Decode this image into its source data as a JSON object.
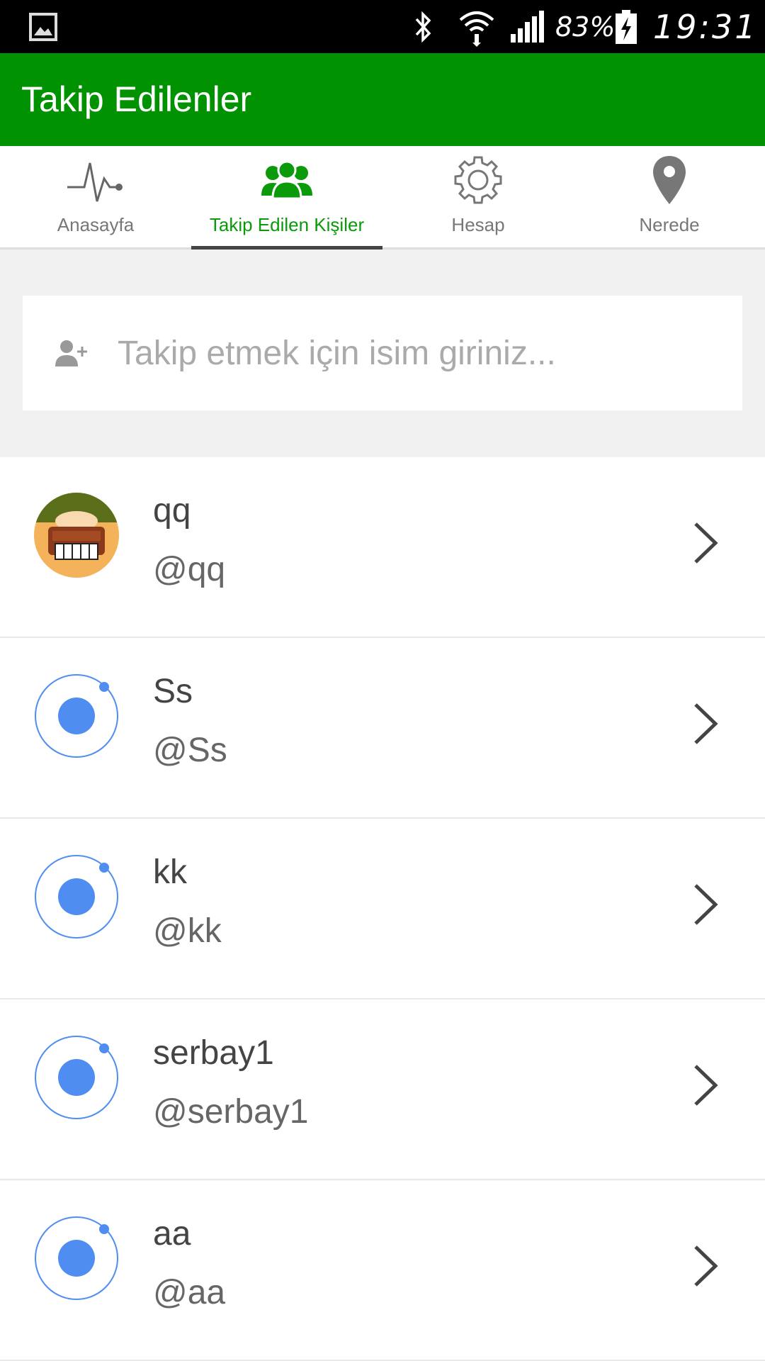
{
  "status_bar": {
    "battery": "83%",
    "time": "19:31",
    "icons": [
      "gallery-icon",
      "bluetooth-icon",
      "wifi-icon",
      "signal-icon",
      "battery-charging-icon"
    ]
  },
  "app_bar": {
    "title": "Takip Edilenler"
  },
  "tabs": [
    {
      "label": "Anasayfa",
      "icon": "pulse-icon"
    },
    {
      "label": "Takip Edilen Kişiler",
      "icon": "people-icon",
      "active": true
    },
    {
      "label": "Hesap",
      "icon": "gear-icon"
    },
    {
      "label": "Nerede",
      "icon": "location-pin-icon"
    }
  ],
  "search": {
    "placeholder": "Takip etmek için isim giriniz...",
    "value": "",
    "icon": "add-user-icon"
  },
  "users": [
    {
      "name": "qq",
      "handle": "@qq",
      "avatar": "photo"
    },
    {
      "name": "Ss",
      "handle": "@Ss",
      "avatar": "default"
    },
    {
      "name": "kk",
      "handle": "@kk",
      "avatar": "default"
    },
    {
      "name": "serbay1",
      "handle": "@serbay1",
      "avatar": "default"
    },
    {
      "name": "aa",
      "handle": "@aa",
      "avatar": "default"
    }
  ],
  "colors": {
    "primary": "#009200",
    "active_tab_text": "#0a9a0a",
    "avatar_blue": "#4f8ef0"
  }
}
